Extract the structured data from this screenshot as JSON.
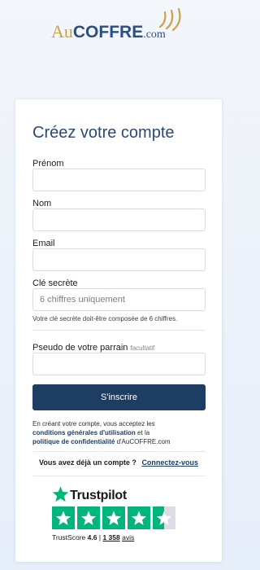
{
  "brand": {
    "logo_au": "Au",
    "logo_coffre": "COFFRE",
    "logo_com": ".com"
  },
  "form": {
    "title": "Créez votre compte",
    "firstname_label": "Prénom",
    "firstname_value": "",
    "lastname_label": "Nom",
    "lastname_value": "",
    "email_label": "Email",
    "email_value": "",
    "secret_label": "Clé secrète",
    "secret_placeholder": "6 chiffres uniquement",
    "secret_hint": "Votre clé secrète doit-être composée de 6 chiffres.",
    "sponsor_label": "Pseudo de votre parrain",
    "sponsor_optional": "facultatif",
    "sponsor_value": "",
    "submit_label": "S'inscrire"
  },
  "legal": {
    "prefix": "En créant votre compte, vous acceptez les",
    "terms_link": "conditions générales d'utilisation",
    "middle": "et la",
    "privacy_link": "politique de confidentialité",
    "suffix": "d'AuCOFFRE.com"
  },
  "login": {
    "question": "Vous avez déjà un compte ?",
    "link": "Connectez-vous"
  },
  "trustpilot": {
    "name": "Trustpilot",
    "score_label": "TrustScore",
    "score": "4.6",
    "separator": "|",
    "review_count": "1 358",
    "reviews_label": "avis",
    "rating_stars": 4.5,
    "star_color": "#00b67a",
    "empty_color": "#dcdce6"
  },
  "colors": {
    "primary": "#1e3d63",
    "title": "#2a4a73",
    "gold": "#c9a24a"
  }
}
